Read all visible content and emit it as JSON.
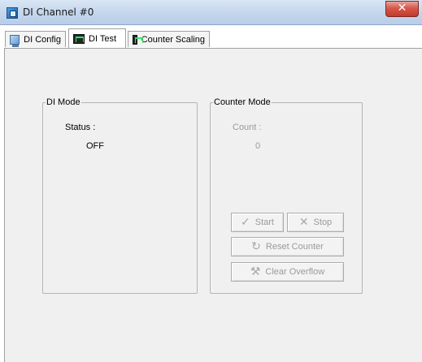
{
  "window": {
    "title": "DI Channel #0",
    "close_symbol": "✕",
    "icon": "app-icon"
  },
  "tabs": [
    {
      "label": "DI Config",
      "icon": "config-icon",
      "active": false
    },
    {
      "label": "DI Test",
      "icon": "scope-icon",
      "active": true
    },
    {
      "label": "Counter Scaling",
      "icon": "scope-icon",
      "active": false
    }
  ],
  "di_mode": {
    "legend": "DI Mode",
    "status_label": "Status :",
    "status_value": "OFF"
  },
  "counter_mode": {
    "legend": "Counter Mode",
    "count_label": "Count :",
    "count_value": "0",
    "start_label": "Start",
    "stop_label": "Stop",
    "reset_label": "Reset Counter",
    "clear_label": "Clear Overflow",
    "enabled": false
  },
  "colors": {
    "disabled_text": "#9a9a9a",
    "panel_bg": "#f0f0f0"
  }
}
